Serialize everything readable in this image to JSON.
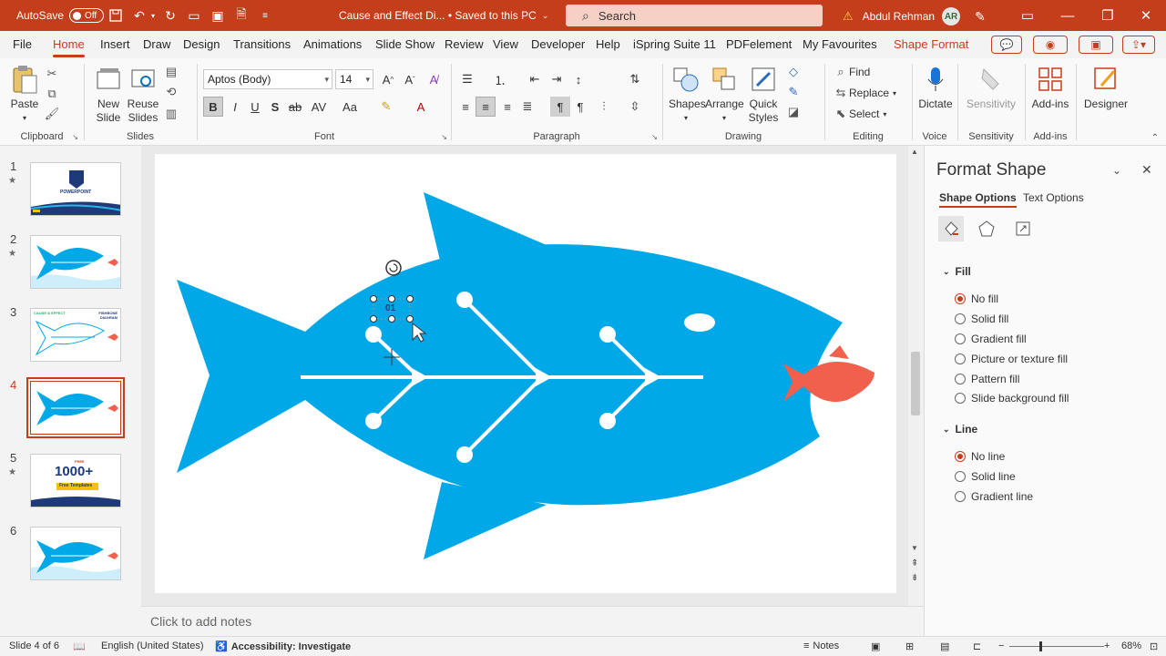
{
  "titlebar": {
    "autosave_label": "AutoSave",
    "autosave_state": "Off",
    "doc_title": "Cause and Effect Di... • Saved to this PC",
    "search_placeholder": "Search",
    "user_name": "Abdul Rehman",
    "user_initials": "AR"
  },
  "menu": {
    "tabs": [
      "File",
      "Home",
      "Insert",
      "Draw",
      "Design",
      "Transitions",
      "Animations",
      "Slide Show",
      "Review",
      "View",
      "Developer",
      "Help",
      "iSpring Suite 11",
      "PDFelement",
      "My Favourites",
      "Shape Format"
    ],
    "active_tab": "Home"
  },
  "ribbon": {
    "clipboard": {
      "paste": "Paste",
      "label": "Clipboard"
    },
    "slides": {
      "new_slide": "New Slide",
      "reuse_slides": "Reuse Slides",
      "label": "Slides"
    },
    "font": {
      "font_name": "Aptos (Body)",
      "font_size": "14",
      "label": "Font"
    },
    "paragraph": {
      "label": "Paragraph"
    },
    "drawing": {
      "shapes": "Shapes",
      "arrange": "Arrange",
      "quick_styles": "Quick Styles",
      "label": "Drawing"
    },
    "editing": {
      "find": "Find",
      "replace": "Replace",
      "select": "Select",
      "label": "Editing"
    },
    "voice": {
      "dictate": "Dictate",
      "label": "Voice"
    },
    "sensitivity": {
      "button": "Sensitivity",
      "label": "Sensitivity"
    },
    "addins": {
      "button": "Add-ins",
      "label": "Add-ins"
    },
    "designer": {
      "button": "Designer"
    }
  },
  "thumbnails": [
    {
      "number": "1",
      "star": "★",
      "selected": false
    },
    {
      "number": "2",
      "star": "★",
      "selected": false
    },
    {
      "number": "3",
      "star": "",
      "selected": false
    },
    {
      "number": "4",
      "star": "",
      "selected": true
    },
    {
      "number": "5",
      "star": "★",
      "selected": false
    },
    {
      "number": "6",
      "star": "",
      "selected": false
    }
  ],
  "thumb_text": {
    "t1_title": "POWERPOINT",
    "t3_title": "CAUSE & EFFECT",
    "t3_right": "FISHBONE DIAGRAM",
    "t5_big": "1000+",
    "t5_sub": "Free Templates",
    "t5_top": "FREE"
  },
  "slide": {
    "selected_label": "01",
    "colors": {
      "fish": "#00a8e8",
      "small_fish": "#f0604d",
      "bone": "#ffffff"
    }
  },
  "notes": {
    "placeholder": "Click to add notes"
  },
  "status": {
    "slide_info": "Slide 4 of 6",
    "language": "English (United States)",
    "accessibility": "Accessibility: Investigate",
    "notes": "Notes",
    "zoom": "68%"
  },
  "format_pane": {
    "title": "Format Shape",
    "tab_shape": "Shape Options",
    "tab_text": "Text Options",
    "fill_section": "Fill",
    "fill_options": [
      "No fill",
      "Solid fill",
      "Gradient fill",
      "Picture or texture fill",
      "Pattern fill",
      "Slide background fill"
    ],
    "fill_selected": 0,
    "line_section": "Line",
    "line_options": [
      "No line",
      "Solid line",
      "Gradient line"
    ],
    "line_selected": 0
  }
}
